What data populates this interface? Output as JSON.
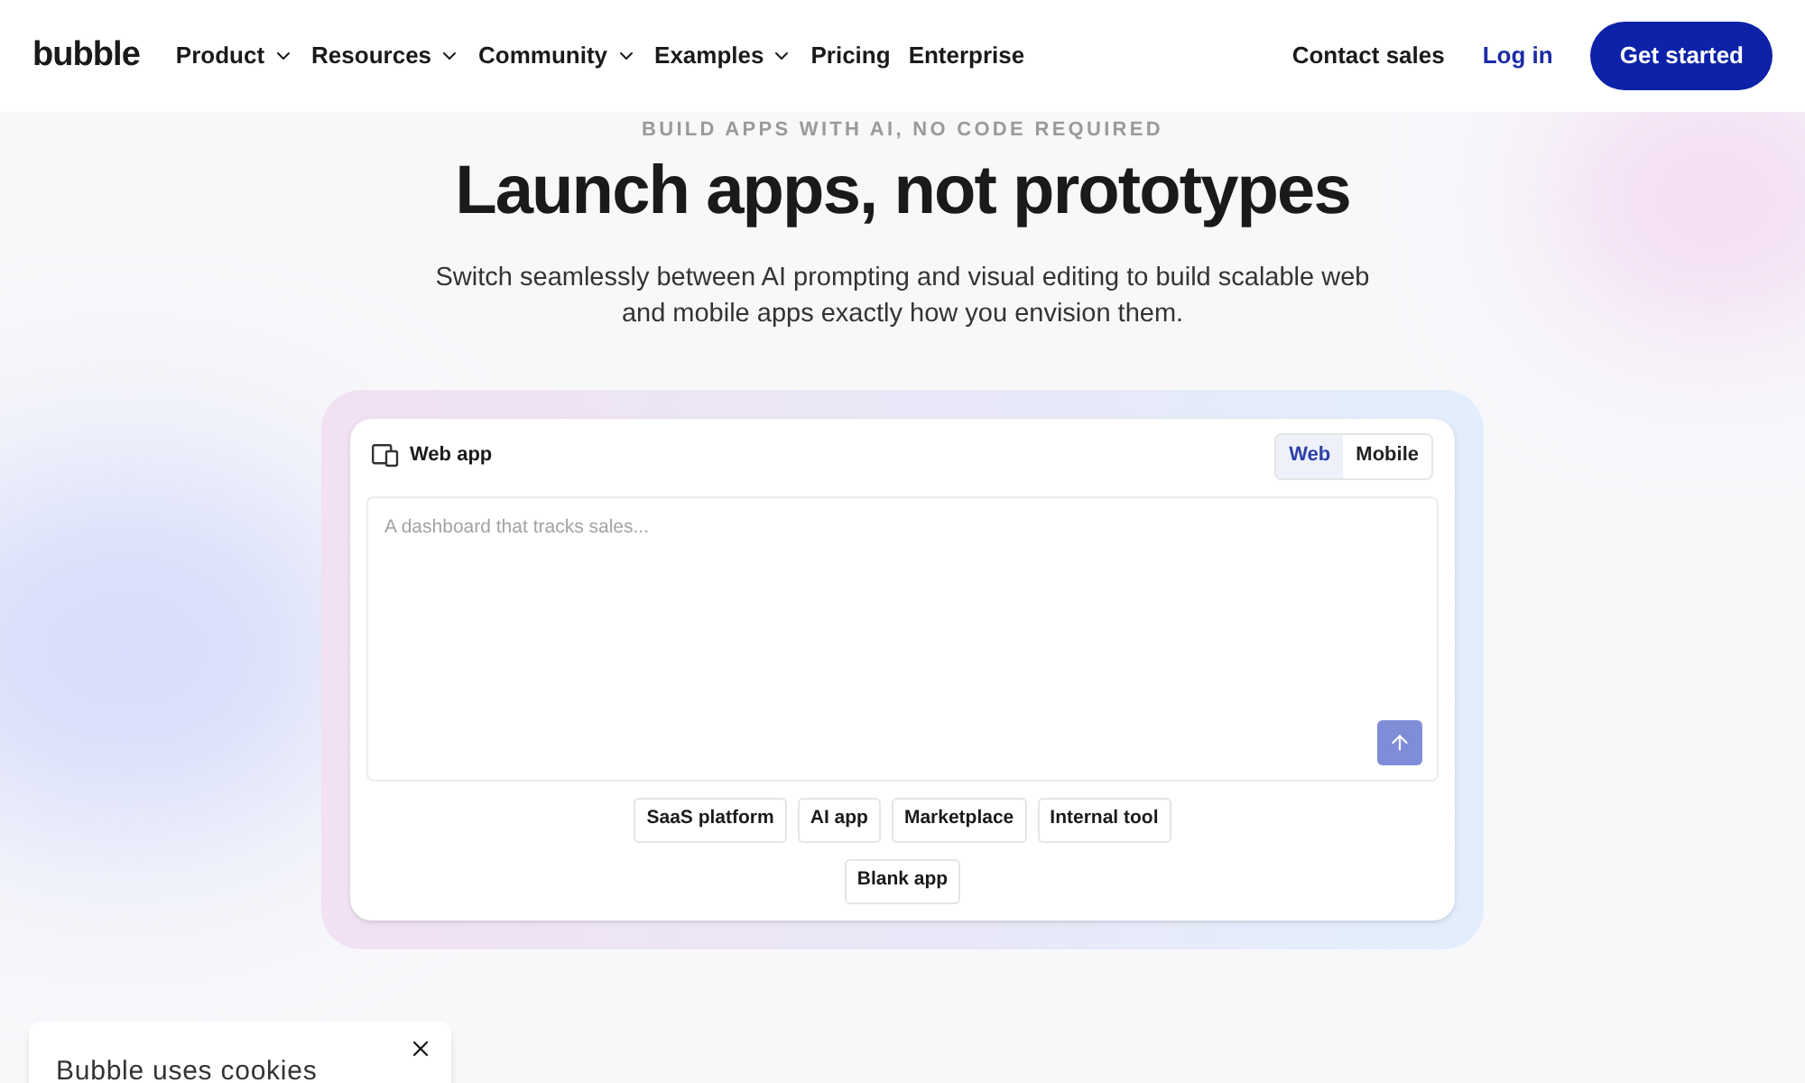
{
  "header": {
    "logo": "bubble",
    "nav": [
      {
        "label": "Product",
        "dropdown": true
      },
      {
        "label": "Resources",
        "dropdown": true
      },
      {
        "label": "Community",
        "dropdown": true
      },
      {
        "label": "Examples",
        "dropdown": true
      },
      {
        "label": "Pricing",
        "dropdown": false
      },
      {
        "label": "Enterprise",
        "dropdown": false
      }
    ],
    "contact": "Contact sales",
    "login": "Log in",
    "cta": "Get started"
  },
  "hero": {
    "eyebrow": "BUILD APPS WITH AI, NO CODE REQUIRED",
    "title": "Launch apps, not prototypes",
    "subtitle": "Switch seamlessly between AI prompting and visual editing to build scalable web and mobile apps exactly how you envision them."
  },
  "builder": {
    "label": "Web app",
    "tabs": [
      {
        "label": "Web",
        "selected": true
      },
      {
        "label": "Mobile",
        "selected": false
      }
    ],
    "prompt": {
      "placeholder": "A dashboard that tracks sales..."
    },
    "templates": [
      [
        "SaaS platform",
        "AI app",
        "Marketplace",
        "Internal tool"
      ],
      [
        "Blank app"
      ]
    ]
  },
  "cookie": {
    "title": "Bubble uses cookies"
  }
}
